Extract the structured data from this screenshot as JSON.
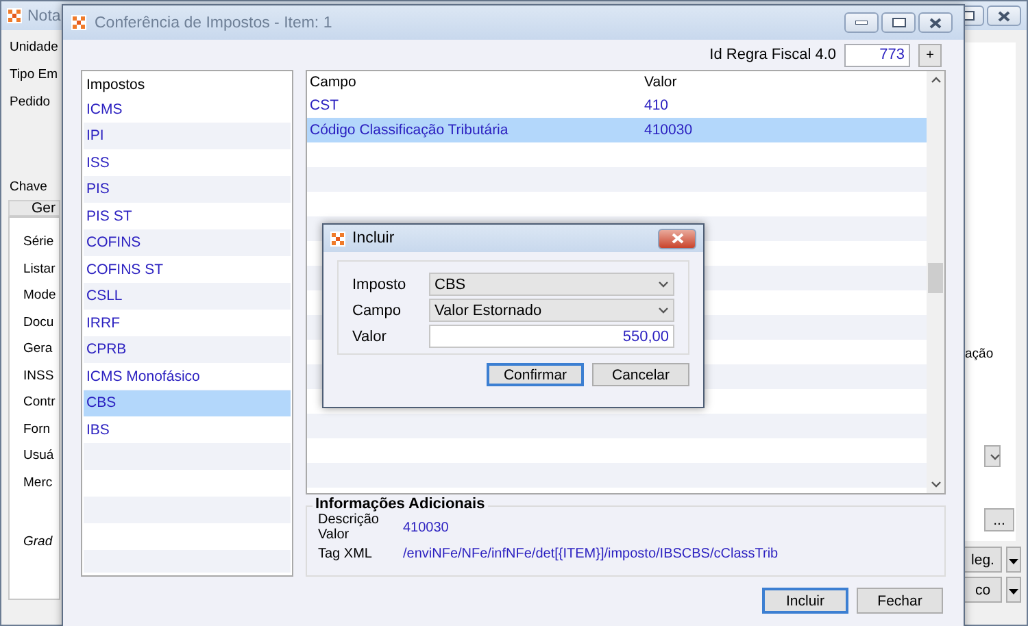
{
  "background_window": {
    "title": "Nota",
    "top_labels": [
      "Unidade",
      "Tipo Em",
      "Pedido",
      "Chave"
    ],
    "tab": "Ger",
    "form_labels": [
      "Série",
      "Listar",
      "Mode",
      "Docu",
      "Gera",
      "INSS",
      "Contr",
      "Forn",
      "Usuá",
      "Merc"
    ],
    "grade_label": "Grad",
    "right_label": "ação",
    "right_buttons": [
      "...",
      "leg.",
      "co"
    ]
  },
  "dialog": {
    "title": "Conferência de Impostos - Item: 1",
    "rule_label": "Id Regra Fiscal 4.0",
    "rule_value": "773",
    "plus_button": "+",
    "taxes_header": "Impostos",
    "taxes": [
      {
        "label": "ICMS",
        "selected": false
      },
      {
        "label": "IPI",
        "selected": false
      },
      {
        "label": "ISS",
        "selected": false
      },
      {
        "label": "PIS",
        "selected": false
      },
      {
        "label": "PIS ST",
        "selected": false
      },
      {
        "label": "COFINS",
        "selected": false
      },
      {
        "label": "COFINS ST",
        "selected": false
      },
      {
        "label": "CSLL",
        "selected": false
      },
      {
        "label": "IRRF",
        "selected": false
      },
      {
        "label": "CPRB",
        "selected": false
      },
      {
        "label": "ICMS Monofásico",
        "selected": false
      },
      {
        "label": "CBS",
        "selected": true
      },
      {
        "label": "IBS",
        "selected": false
      }
    ],
    "grid_columns": [
      "Campo",
      "Valor"
    ],
    "grid_rows": [
      {
        "campo": "CST",
        "valor": "410",
        "selected": false
      },
      {
        "campo": "Código Classificação Tributária",
        "valor": "410030",
        "selected": true
      }
    ],
    "info": {
      "title": "Informações Adicionais",
      "fields": [
        {
          "label": "Descrição Valor",
          "value": "410030"
        },
        {
          "label": "Tag XML",
          "value": "/enviNFe/NFe/infNFe/det[{ITEM}]/imposto/IBSCBS/cClassTrib"
        }
      ]
    },
    "buttons": [
      {
        "label": "Incluir",
        "focused": true
      },
      {
        "label": "Fechar",
        "focused": false
      }
    ]
  },
  "include_dialog": {
    "title": "Incluir",
    "fields": [
      {
        "kind": "select",
        "label": "Imposto",
        "value": "CBS"
      },
      {
        "kind": "select",
        "label": "Campo",
        "value": "Valor Estornado"
      },
      {
        "kind": "input",
        "label": "Valor",
        "value": "550,00"
      }
    ],
    "buttons": [
      {
        "label": "Confirmar",
        "focused": true
      },
      {
        "label": "Cancelar",
        "focused": false
      }
    ]
  }
}
